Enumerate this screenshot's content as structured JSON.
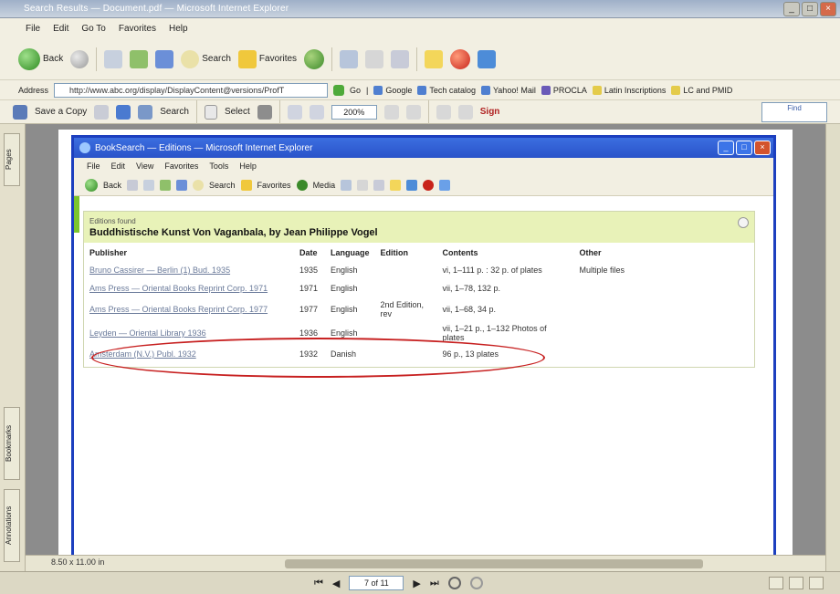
{
  "outer": {
    "title": "Search Results — Document.pdf — Microsoft Internet Explorer",
    "menu": [
      "File",
      "Edit",
      "Go To",
      "Favorites",
      "Help"
    ],
    "toolbar": {
      "back": "Back",
      "search": "Search",
      "favorites": "Favorites"
    },
    "address": {
      "label": "Address",
      "value": "http://www.abc.org/display/DisplayContent@versions/ProfT",
      "go": "Go",
      "links": [
        "Google",
        "Tech catalog",
        "Yahoo! Mail",
        "PROCLA",
        "Latin Inscriptions",
        "LC and PMID"
      ]
    },
    "pdfbar": {
      "save": "Save a Copy",
      "search": "Search",
      "select": "Select",
      "zoom": "200%",
      "sign": "Sign",
      "search_box": "Find"
    },
    "leftnav": {
      "tabs": [
        "Pages",
        "Bookmarks",
        "Annotations"
      ]
    },
    "hscroll": {
      "page_size": "8.50 x 11.00 in"
    },
    "status": {
      "first": "⏮",
      "prev": "◀",
      "page": "7 of 11",
      "next": "▶",
      "last": "⏭"
    }
  },
  "inner": {
    "title": "BookSearch — Editions — Microsoft Internet Explorer",
    "menu": [
      "File",
      "Edit",
      "View",
      "Favorites",
      "Tools",
      "Help"
    ],
    "toolbar": {
      "back": "Back",
      "search": "Search",
      "favorites": "Favorites",
      "media": "Media"
    },
    "book": {
      "crumb": "Editions found",
      "title": "Buddhistische Kunst Von Vaganbala, by Jean Philippe Vogel"
    },
    "table": {
      "headers": [
        "Publisher",
        "Date",
        "Language",
        "Edition",
        "Contents",
        "Other"
      ],
      "rows": [
        {
          "publisher": "Bruno Cassirer — Berlin (1) Bud. 1935",
          "date": "1935",
          "language": "English",
          "edition": "",
          "contents": "vi, 1–111 p. : 32 p. of plates",
          "other": "Multiple files"
        },
        {
          "publisher": "Ams Press — Oriental Books Reprint Corp. 1971",
          "date": "1971",
          "language": "English",
          "edition": "",
          "contents": "vii, 1–78, 132 p.",
          "other": ""
        },
        {
          "publisher": "Ams Press — Oriental Books Reprint Corp. 1977",
          "date": "1977",
          "language": "English",
          "edition": "2nd Edition, rev",
          "contents": "vii, 1–68, 34 p.",
          "other": ""
        },
        {
          "publisher": "Leyden — Oriental Library 1936",
          "date": "1936",
          "language": "English",
          "edition": "",
          "contents": "vii, 1–21 p., 1–132 Photos of plates",
          "other": ""
        },
        {
          "publisher": "Amsterdam (N.V.) Publ. 1932",
          "date": "1932",
          "language": "Danish",
          "edition": "",
          "contents": "96 p., 13 plates",
          "other": ""
        }
      ]
    }
  }
}
